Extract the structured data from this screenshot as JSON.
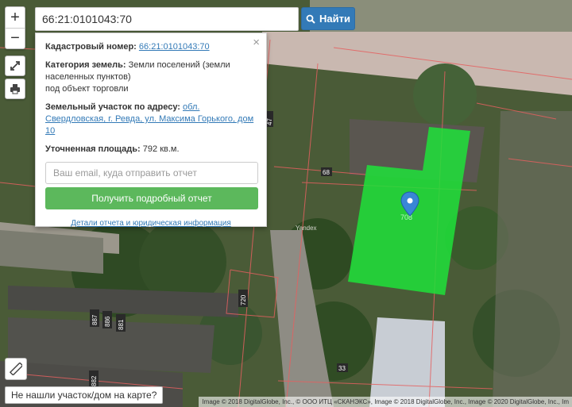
{
  "search": {
    "value": "66:21:0101043:70",
    "button_label": "Найти"
  },
  "zoom": {
    "in_label": "+",
    "out_label": "−"
  },
  "info": {
    "cadastral_label": "Кадастровый номер:",
    "cadastral_value": "66:21:0101043:70",
    "category_label": "Категория земель:",
    "category_value": "Земли поселений (земли населенных пунктов)",
    "category_use": "под объект торговли",
    "address_label": "Земельный участок по адресу:",
    "address_value": "обл. Свердловская, г. Ревда, ул. Максима Горького, дом 10",
    "area_label": "Уточненная площадь:",
    "area_value": "792 кв.м.",
    "email_placeholder": "Ваш email, куда отправить отчет",
    "report_button": "Получить подробный отчет",
    "details_link": "Детали отчета и юридическая информация",
    "close": "×"
  },
  "map_labels": {
    "parcel_68": "68",
    "parcel_720": "720",
    "parcel_887": "887",
    "parcel_886": "886",
    "parcel_881": "881",
    "parcel_882": "882",
    "parcel_33": "33",
    "parcel_47": "47",
    "parcel_708": "708",
    "yandex": "Yandex"
  },
  "footer": {
    "not_found": "Не нашли участок/дом на карте?",
    "attribution": "Image © 2018 DigitalGlobe, Inc., © ООО ИТЦ «СКАНЭКС», Image © 2018 DigitalGlobe, Inc., Image © 2020 DigitalGlobe, Inc., Im"
  },
  "colors": {
    "highlight": "#1fe23a",
    "marker": "#3a86d6",
    "accent": "#337ab7",
    "report": "#5cb85c"
  }
}
